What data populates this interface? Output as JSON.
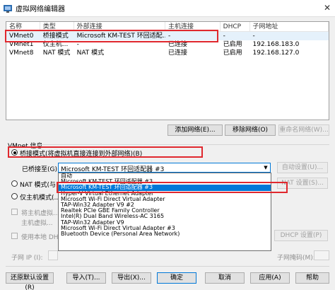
{
  "window": {
    "title": "虚拟网络编辑器",
    "close_glyph": "✕"
  },
  "list": {
    "headers": [
      "名称",
      "类型",
      "外部连接",
      "主机连接",
      "DHCP",
      "子网地址"
    ],
    "rows": [
      [
        "VMnet0",
        "桥接模式",
        "Microsoft KM-TEST 环回适配...",
        "-",
        "-",
        "-"
      ],
      [
        "VMnet1",
        "仅主机...",
        "-",
        "已连接",
        "已启用",
        "192.168.183.0"
      ],
      [
        "VMnet8",
        "NAT 模式",
        "NAT 模式",
        "已连接",
        "已启用",
        "192.168.127.0"
      ]
    ]
  },
  "network_buttons": {
    "add": "添加网络(E)...",
    "remove": "移除网络(O)",
    "rename": "重命名网络(W)..."
  },
  "info": {
    "title": "VMnet 信息",
    "bridged": "桥接模式(将虚拟机直接连接到外部网络)(B)",
    "bridged_to": "已桥接至(G):",
    "bridged_value": "Microsoft KM-TEST 环回适配器 #3",
    "auto_settings": "自动设置(U)...",
    "nat": "NAT 模式(与...",
    "nat_settings": "NAT 设置(S)...",
    "host_only": "仅主机模式(...",
    "connect_adapter": "将主机虚拟...",
    "adapter_name": "主机虚拟...",
    "use_dhcp": "使用本地 DHC...",
    "dhcp_settings": "DHCP 设置(P)",
    "subnet_ip": "子网 IP (I):",
    "subnet_mask": "子网掩码(M):"
  },
  "dropdown_options": [
    "自动",
    "Microsoft KM-TEST 环回适配器 #3",
    "Microsoft KM-TEST 环回适配器 #3",
    "Hyper-V Virtual Ethernet Adapter",
    "Microsoft Wi-Fi Direct Virtual Adapter",
    "TAP-Win32 Adapter V9 #2",
    "Realtek PCIe GBE Family Controller",
    "Intel(R) Dual Band Wireless-AC 3165",
    "TAP-Win32 Adapter V9",
    "Microsoft Wi-Fi Direct Virtual Adapter #3",
    "Bluetooth Device (Personal Area Network)"
  ],
  "bottom_buttons": {
    "restore": "还原默认设置(R)",
    "import": "导入(T)...",
    "export": "导出(X)...",
    "ok": "确定",
    "cancel": "取消",
    "apply": "应用(A)",
    "help": "帮助"
  },
  "colors": {
    "highlight": "#0078d7",
    "annotation_red": "#e0282e",
    "selected_row": "#e5f1fb"
  }
}
